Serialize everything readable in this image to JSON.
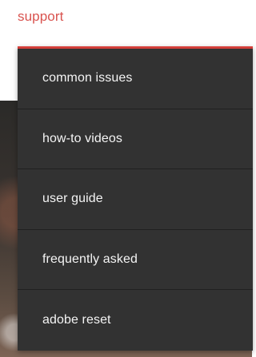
{
  "nav": {
    "label": "support"
  },
  "dropdown": {
    "items": [
      {
        "label": "common issues"
      },
      {
        "label": "how-to videos"
      },
      {
        "label": "user guide"
      },
      {
        "label": "frequently asked"
      },
      {
        "label": "adobe reset"
      }
    ]
  },
  "colors": {
    "accent": "#d9534f",
    "menu_bg": "#323232",
    "menu_text": "#f4f4f4"
  }
}
